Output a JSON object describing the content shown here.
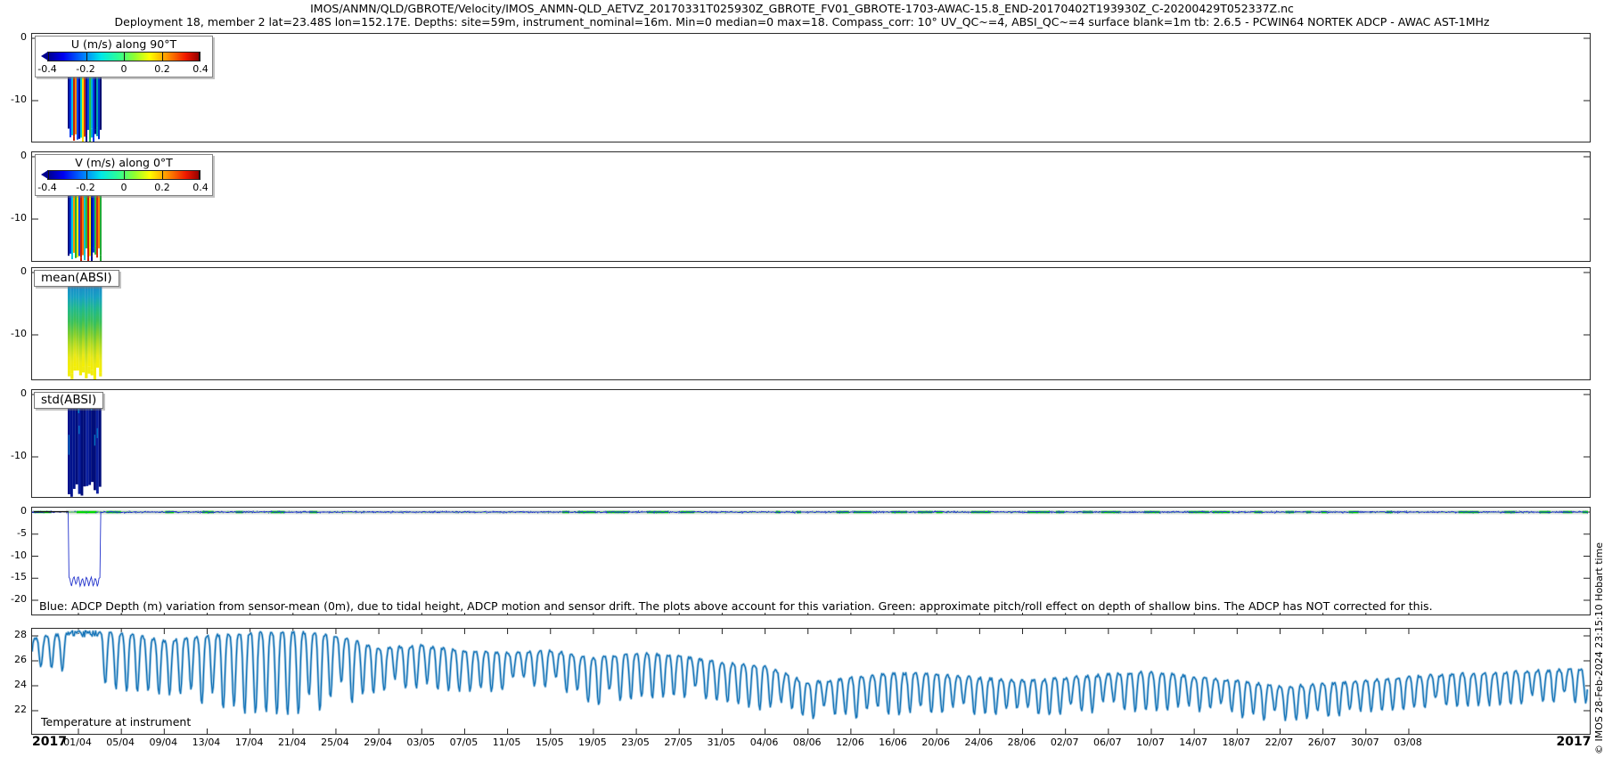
{
  "title": {
    "line1": "IMOS/ANMN/QLD/GBROTE/Velocity/IMOS_ANMN-QLD_AETVZ_20170331T025930Z_GBROTE_FV01_GBROTE-1703-AWAC-15.8_END-20170402T193930Z_C-20200429T052337Z.nc",
    "line2": "Deployment 18, member 2 lat=23.48S lon=152.17E. Depths: site=59m, instrument_nominal=16m. Min=0 median=0 max=18. Compass_corr: 10° UV_QC~=4, ABSI_QC~=4 surface blank=1m tb: 2.6.5 - PCWIN64 NORTEK ADCP - AWAC AST-1MHz"
  },
  "watermark": "© IMOS 28-Feb-2024 23:15:10 Hobart time",
  "x_axis": {
    "year_left": "2017",
    "year_right": "2017",
    "tick_interval_days": 4,
    "date_labels": [
      "01/04",
      "05/04",
      "09/04",
      "13/04",
      "17/04",
      "21/04",
      "25/04",
      "29/04",
      "03/05",
      "07/05",
      "11/05",
      "15/05",
      "19/05",
      "23/05",
      "27/05",
      "31/05",
      "04/06",
      "08/06",
      "12/06",
      "16/06",
      "20/06",
      "24/06",
      "28/06",
      "02/07",
      "06/07",
      "10/07",
      "14/07",
      "18/07",
      "22/07",
      "26/07",
      "30/07",
      "03/08"
    ]
  },
  "panels": {
    "u": {
      "legend_title": "U (m/s) along 90°T",
      "colorbar_labels": [
        "-0.4",
        "-0.2",
        "0",
        "0.2",
        "0.4"
      ],
      "ytick_values": [
        0,
        -10
      ],
      "ytick_labels": [
        "0",
        "-10"
      ]
    },
    "v": {
      "legend_title": "V (m/s) along 0°T",
      "colorbar_labels": [
        "-0.4",
        "-0.2",
        "0",
        "0.2",
        "0.4"
      ],
      "ytick_values": [
        0,
        -10
      ],
      "ytick_labels": [
        "0",
        "-10"
      ]
    },
    "mean_absi": {
      "label": "mean(ABSI)",
      "ytick_values": [
        0,
        -10
      ],
      "ytick_labels": [
        "0",
        "-10"
      ]
    },
    "std_absi": {
      "label": "std(ABSI)",
      "ytick_values": [
        0,
        -10
      ],
      "ytick_labels": [
        "0",
        "-10"
      ]
    },
    "depth": {
      "caption": "Blue: ADCP Depth (m) variation from sensor-mean (0m), due to tidal height, ADCP motion and sensor drift. The plots above account for this variation. Green: approximate pitch/roll effect on depth of shallow bins. The ADCP has NOT corrected for this.",
      "ytick_values": [
        0,
        -5,
        -10,
        -15,
        -20
      ],
      "ytick_labels": [
        "0",
        "-5",
        "-10",
        "-15",
        "-20"
      ]
    },
    "temperature": {
      "label": "Temperature at instrument",
      "ytick_values": [
        28,
        26,
        24,
        22
      ],
      "ytick_labels": [
        "28",
        "26",
        "24",
        "22"
      ]
    }
  },
  "chart_data": [
    {
      "type": "heatmap",
      "panel": "U velocity",
      "title": "U (m/s) along 90°T",
      "units": "m/s",
      "colormap": "jet",
      "clim": [
        -0.4,
        0.4
      ],
      "colorbar_ticks": [
        -0.4,
        -0.2,
        0,
        0.2,
        0.4
      ],
      "yticks": [
        0,
        -10
      ],
      "ylim": [
        0,
        -17
      ],
      "data_window": {
        "start": "31/03/2017",
        "end": "02/04/2017"
      },
      "stripe_colors": [
        "#000d8a",
        "#0033f5",
        "#00c4e6",
        "#c62507",
        "#ff8a00",
        "#0041ff",
        "#000a96",
        "#00d2cf",
        "#ffdf00",
        "#d23510",
        "#001199",
        "#0047e6",
        "#2fbf43",
        "#00b2d4",
        "#0038f0",
        "#000b82",
        "#00a3a8",
        "#0030d2",
        "#000c74"
      ]
    },
    {
      "type": "heatmap",
      "panel": "V velocity",
      "title": "V (m/s) along 0°T",
      "units": "m/s",
      "colormap": "jet",
      "clim": [
        -0.4,
        0.4
      ],
      "colorbar_ticks": [
        -0.4,
        -0.2,
        0,
        0.2,
        0.4
      ],
      "yticks": [
        0,
        -10
      ],
      "ylim": [
        0,
        -17
      ],
      "data_window": {
        "start": "31/03/2017",
        "end": "02/04/2017"
      },
      "stripe_colors": [
        "#000b84",
        "#0038e0",
        "#00cbd8",
        "#ff9300",
        "#22b135",
        "#ffe800",
        "#0042ff",
        "#c92105",
        "#ff7300",
        "#00c2d2",
        "#2bb83b",
        "#c91d05",
        "#f0e300",
        "#000d92",
        "#0032e2",
        "#34ba42",
        "#d22b10",
        "#ff8400",
        "#23aa35"
      ]
    },
    {
      "type": "heatmap",
      "panel": "mean(ABSI)",
      "yticks": [
        0,
        -10
      ],
      "ylim": [
        0,
        -17
      ],
      "data_window": {
        "start": "31/03/2017",
        "end": "02/04/2017"
      },
      "column_gradient": [
        "#2aa9d8",
        "#1b89c9",
        "#18a2c2",
        "#22b98a",
        "#3ac05a",
        "#79cc31",
        "#b9dc20",
        "#e9e818",
        "#f5ef00"
      ]
    },
    {
      "type": "heatmap",
      "panel": "std(ABSI)",
      "yticks": [
        0,
        -10
      ],
      "ylim": [
        0,
        -17
      ],
      "data_window": {
        "start": "31/03/2017",
        "end": "02/04/2017"
      },
      "column_colors": [
        "#000d7a",
        "#00128c",
        "#0a1fa0"
      ],
      "accent_color": "#00a0e0"
    },
    {
      "type": "line",
      "panel": "ADCP depth variation",
      "yticks": [
        0,
        -5,
        -10,
        -15,
        -20
      ],
      "ylim": [
        1,
        -23
      ],
      "blue_line": "ADCP Depth (m) variation from sensor-mean (0m); ~0 for whole record except deployment dip",
      "green_line": "approximate pitch/roll effect on depth of shallow bins, ~0 m",
      "dip": {
        "start": "31/03/2017",
        "end": "02/04/2017",
        "typical_m": -15.7,
        "min_m": -16.6
      },
      "colors": {
        "blue": "#2233cc",
        "green": "#00d800"
      }
    },
    {
      "type": "line",
      "panel": "Temperature at instrument",
      "yticks": [
        28,
        26,
        24,
        22
      ],
      "ylim": [
        20,
        28.6
      ],
      "x_start_day_offset": -4,
      "sample_interval_days": 4,
      "x_labels_aligned": "01/04 .. 03/08 every 4 days",
      "tmin": [
        25.6,
        25.0,
        23.6,
        23.4,
        22.4,
        21.8,
        21.6,
        22.2,
        23.6,
        23.8,
        23.5,
        23.6,
        24.0,
        22.4,
        23.0,
        23.2,
        22.8,
        22.0,
        21.5,
        21.3,
        21.6,
        21.8,
        21.8,
        21.6,
        21.8,
        22.0,
        22.0,
        21.9,
        21.6,
        21.1,
        21.5,
        22.0,
        22.2,
        22.4,
        22.5,
        22.6,
        22.7
      ],
      "tmax": [
        27.8,
        28.3,
        28.2,
        27.6,
        28.0,
        28.2,
        28.3,
        28.0,
        27.0,
        27.2,
        26.8,
        26.6,
        26.8,
        26.2,
        26.6,
        26.4,
        25.8,
        25.6,
        24.2,
        24.6,
        25.0,
        24.9,
        24.6,
        24.4,
        24.6,
        24.9,
        25.1,
        24.7,
        24.4,
        23.9,
        24.1,
        24.4,
        24.7,
        24.9,
        25.0,
        25.2,
        25.3
      ],
      "line_color": "#1674b8"
    }
  ]
}
